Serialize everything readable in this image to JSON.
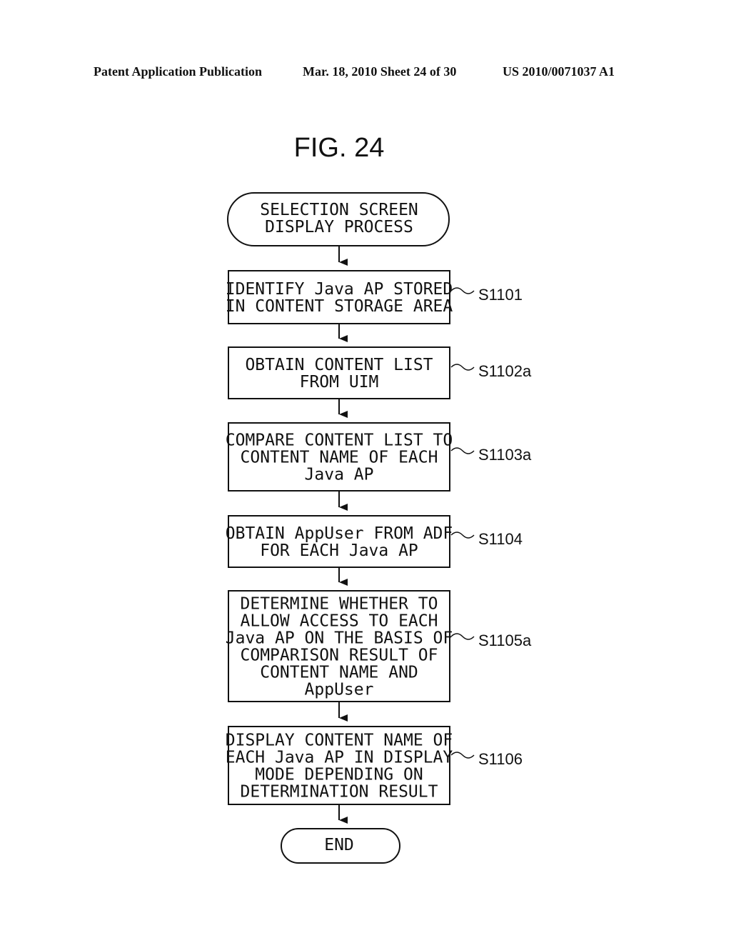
{
  "header": {
    "publication": "Patent Application Publication",
    "date_sheet": "Mar. 18, 2010  Sheet 24 of 30",
    "number": "US 2010/0071037 A1"
  },
  "figure": {
    "title": "FIG. 24"
  },
  "flowchart": {
    "start": {
      "lines": [
        "SELECTION SCREEN",
        "DISPLAY PROCESS"
      ]
    },
    "steps": [
      {
        "id": "S1101",
        "label": "S1101",
        "lines": [
          "IDENTIFY Java AP STORED",
          "IN CONTENT STORAGE AREA"
        ]
      },
      {
        "id": "S1102a",
        "label": "S1102a",
        "lines": [
          "OBTAIN CONTENT LIST",
          "FROM UIM"
        ]
      },
      {
        "id": "S1103a",
        "label": "S1103a",
        "lines": [
          "COMPARE CONTENT LIST TO",
          "CONTENT NAME OF EACH",
          "Java AP"
        ]
      },
      {
        "id": "S1104",
        "label": "S1104",
        "lines": [
          "OBTAIN AppUser FROM ADF",
          "FOR EACH Java AP"
        ]
      },
      {
        "id": "S1105a",
        "label": "S1105a",
        "lines": [
          "DETERMINE WHETHER TO",
          "ALLOW ACCESS TO EACH",
          "Java AP ON THE BASIS OF",
          "COMPARISON RESULT OF",
          "CONTENT NAME AND",
          "AppUser"
        ]
      },
      {
        "id": "S1106",
        "label": "S1106",
        "lines": [
          "DISPLAY CONTENT NAME OF",
          "EACH Java AP IN DISPLAY",
          "MODE DEPENDING ON",
          "DETERMINATION RESULT"
        ]
      }
    ],
    "end": {
      "lines": [
        "END"
      ]
    }
  }
}
